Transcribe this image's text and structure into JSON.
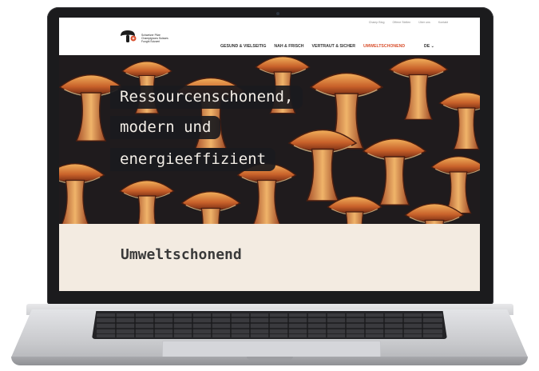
{
  "utility_links": [
    "Champ Blog",
    "Offene Stellen",
    "Über uns",
    "Kontakt"
  ],
  "logo": {
    "text_lines": [
      "Schweizer Pilze",
      "Champignons Suisses",
      "Funghi Svizzeri"
    ]
  },
  "nav": {
    "items": [
      {
        "label": "GESUND & VIELSEITIG",
        "active": false
      },
      {
        "label": "NAH & FRISCH",
        "active": false
      },
      {
        "label": "VERTRAUT & SICHER",
        "active": false
      },
      {
        "label": "UMWELTSCHONEND",
        "active": true
      }
    ],
    "language": "DE ⌄"
  },
  "hero": {
    "lines": [
      "Ressourcenschonend,",
      "modern und",
      "energieeffizient"
    ]
  },
  "section": {
    "title": "Umweltschonend"
  },
  "colors": {
    "accent": "#d9512f",
    "section_bg": "#f3ebe1",
    "hero_bar": "#1a1a1e"
  }
}
